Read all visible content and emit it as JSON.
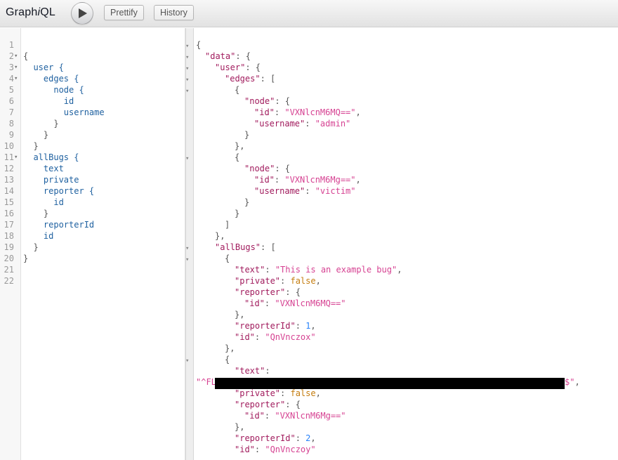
{
  "app": {
    "title_prefix": "Graph",
    "title_italic": "i",
    "title_suffix": "QL"
  },
  "toolbar": {
    "run_icon": "play-icon",
    "prettify_label": "Prettify",
    "history_label": "History"
  },
  "query": {
    "line_numbers": [
      "1",
      "2",
      "3",
      "4",
      "5",
      "6",
      "7",
      "8",
      "9",
      "10",
      "11",
      "12",
      "13",
      "14",
      "15",
      "16",
      "17",
      "18",
      "19",
      "20",
      "21",
      "22"
    ],
    "lines": [
      "",
      "{",
      "  user {",
      "    edges {",
      "      node {",
      "        id",
      "        username",
      "      }",
      "    }",
      "  }",
      "  allBugs {",
      "    text",
      "    private",
      "    reporter {",
      "      id",
      "    }",
      "    reporterId",
      "    id",
      "  }",
      "}",
      "",
      ""
    ]
  },
  "result": {
    "open_brace": "{",
    "key_data": "\"data\"",
    "key_user": "\"user\"",
    "key_edges": "\"edges\"",
    "key_node": "\"node\"",
    "key_id": "\"id\"",
    "key_username": "\"username\"",
    "key_allbugs": "\"allBugs\"",
    "key_text": "\"text\"",
    "key_private": "\"private\"",
    "key_reporter": "\"reporter\"",
    "key_reporterid": "\"reporterId\"",
    "val_user1_id": "\"VXNlcnM6MQ==\"",
    "val_user1_username": "\"admin\"",
    "val_user2_id": "\"VXNlcnM6Mg==\"",
    "val_user2_username": "\"victim\"",
    "val_bug1_text": "\"This is an example bug\"",
    "val_bug1_private": "false",
    "val_bug1_reporter_id": "\"VXNlcnM6MQ==\"",
    "val_bug1_reporterid": "1",
    "val_bug1_id": "\"QnVnczox\"",
    "val_bug2_text_start": "\"^FL",
    "val_bug2_text_end": "$\"",
    "val_bug2_private": "false",
    "val_bug2_reporter_id": "\"VXNlcnM6Mg==\"",
    "val_bug2_reporterid": "2",
    "val_bug2_id": "\"QnVnczoy\""
  }
}
